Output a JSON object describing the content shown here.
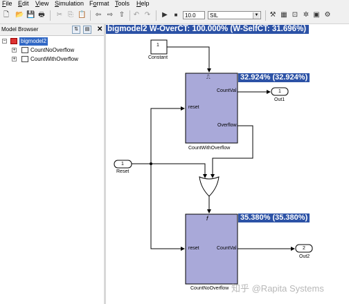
{
  "menu": {
    "items": [
      {
        "label": "File",
        "key": "F"
      },
      {
        "label": "Edit",
        "key": "E"
      },
      {
        "label": "View",
        "key": "V"
      },
      {
        "label": "Simulation",
        "key": "S"
      },
      {
        "label": "Format",
        "key": "o"
      },
      {
        "label": "Tools",
        "key": "T"
      },
      {
        "label": "Help",
        "key": "H"
      }
    ]
  },
  "toolbar": {
    "stop_time": "10.0",
    "solver_mode": "SIL"
  },
  "model_browser": {
    "title": "Model Browser",
    "tree": [
      {
        "label": "bigmodel2",
        "selected": true
      },
      {
        "label": "CountNoOverflow"
      },
      {
        "label": "CountWithOverflow"
      }
    ]
  },
  "diagram": {
    "title": "bigmodel2 W-OverCT: 100.000% (W-SelfCT: 31.696%)",
    "constant_value": "1",
    "constant_label": "Constant",
    "reset_port_number": "1",
    "reset_label": "Reset",
    "out1_number": "1",
    "out1_label": "Out1",
    "out2_number": "2",
    "out2_label": "Out2",
    "block1": {
      "name": "CountWithOverflow",
      "coverage": "32.924% (32.924%)",
      "port_reset": "reset",
      "port_countval": "CountVal",
      "port_overflow": "Overflow",
      "trigger_symbol": "⎍"
    },
    "block2": {
      "name": "CountNoOverflow",
      "coverage": "35.380% (35.380%)",
      "port_reset": "reset",
      "port_countval": "CountVal",
      "trigger_symbol": "f"
    }
  },
  "watermark": "知乎 @Rapita Systems",
  "colors": {
    "highlight_bg": "#2c52a6",
    "subsystem_fill": "#a9a9d9",
    "line": "#000000"
  }
}
